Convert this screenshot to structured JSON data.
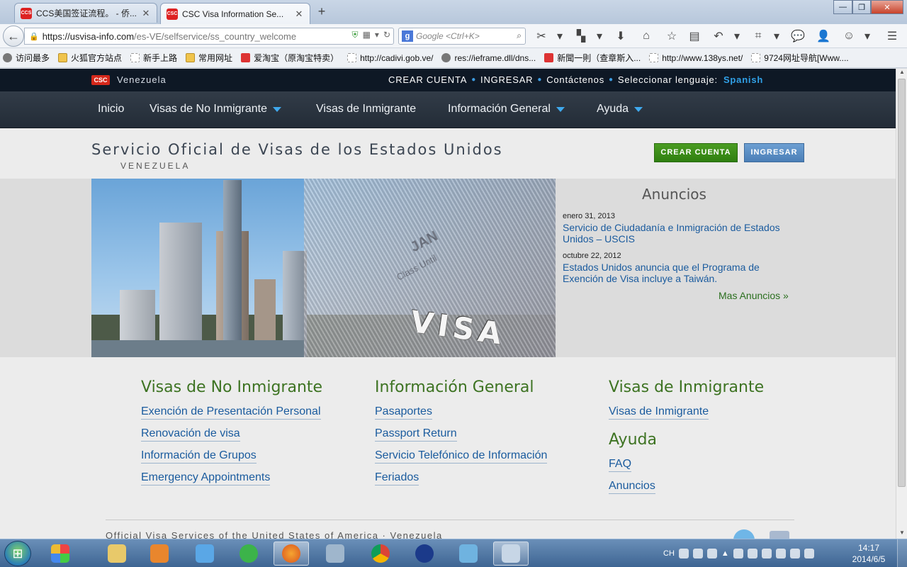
{
  "browser": {
    "tabs": [
      {
        "title": "CCS美国签证流程。 - 侨...",
        "favicon": "CCS",
        "active": false
      },
      {
        "title": "CSC Visa Information Se...",
        "favicon": "CSC",
        "active": true
      }
    ],
    "url_domain": "https://usvisa-info.com",
    "url_path": "/es-VE/selfservice/ss_country_welcome",
    "search_placeholder": "Google <Ctrl+K>",
    "search_engine_glyph": "g",
    "bookmarks": [
      {
        "label": "访问最多",
        "icon": "gear"
      },
      {
        "label": "火狐官方站点",
        "icon": "folder"
      },
      {
        "label": "新手上路",
        "icon": "page"
      },
      {
        "label": "常用网址",
        "icon": "folder"
      },
      {
        "label": "爱淘宝（原淘宝特卖）",
        "icon": "red"
      },
      {
        "label": "http://cadivi.gob.ve/",
        "icon": "page"
      },
      {
        "label": "res://ieframe.dll/dns...",
        "icon": "gear"
      },
      {
        "label": "新聞一則（查章斯入...",
        "icon": "red"
      },
      {
        "label": "http://www.138ys.net/",
        "icon": "page"
      },
      {
        "label": "9724网址导航[Www....",
        "icon": "page"
      }
    ]
  },
  "site": {
    "logo": "CSC",
    "country": "Venezuela",
    "top_links": [
      "CREAR CUENTA",
      "INGRESAR",
      "Contáctenos",
      "Seleccionar lenguaje:"
    ],
    "language": "Spanish",
    "nav": [
      {
        "label": "Inicio",
        "dropdown": false
      },
      {
        "label": "Visas de No Inmigrante",
        "dropdown": true
      },
      {
        "label": "Visas de Inmigrante",
        "dropdown": false
      },
      {
        "label": "Información General",
        "dropdown": true
      },
      {
        "label": "Ayuda",
        "dropdown": true
      }
    ],
    "title": "Servicio Oficial de Visas de los Estados Unidos",
    "subtitle": "VENEZUELA",
    "btn_create": "CREAR CUENTA",
    "btn_login": "INGRESAR",
    "hero": {
      "visa_word": "VISA",
      "stamp_1": "JAN",
      "stamp_2": "Class Until"
    },
    "announcements": {
      "heading": "Anuncios",
      "items": [
        {
          "date": "enero 31, 2013",
          "text": "Servicio de Ciudadanía e Inmigración de Estados Unidos – USCIS"
        },
        {
          "date": "octubre 22, 2012",
          "text": "Estados Unidos anuncia que el Programa de Exención de Visa incluye a Taiwán."
        }
      ],
      "more": "Mas Anuncios »"
    },
    "columns": [
      {
        "heading": "Visas de No Inmigrante",
        "links": [
          "Exención de Presentación Personal",
          "Renovación de visa",
          "Información de Grupos",
          "Emergency Appointments"
        ]
      },
      {
        "heading": "Información General",
        "links": [
          "Pasaportes",
          "Passport Return",
          "Servicio Telefónico de Información",
          "Feriados"
        ]
      },
      {
        "heading": "Visas de Inmigrante",
        "links": [
          "Visas de Inmigrante"
        ]
      },
      {
        "heading": "Ayuda",
        "links": [
          "FAQ",
          "Anuncios"
        ]
      }
    ],
    "footer": "Official Visa Services of the United States of America · Venezuela"
  },
  "taskbar": {
    "lang": "CH",
    "time": "14:17",
    "date": "2014/6/5"
  },
  "colors": {
    "nav_dark": "#0e1825",
    "accent_blue": "#31a1e8",
    "link_blue": "#1a5b9e",
    "heading_green": "#3d7322",
    "button_green": "#3a8c18",
    "button_blue": "#5a8cc4"
  }
}
